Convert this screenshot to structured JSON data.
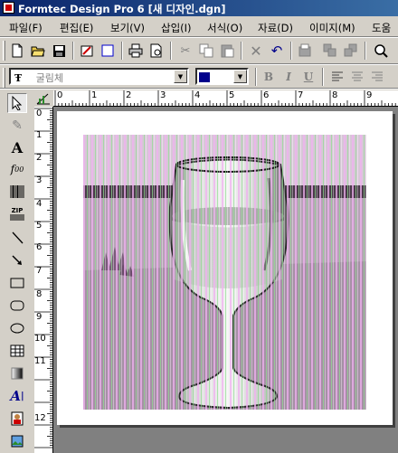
{
  "window": {
    "title": "Formtec Design Pro 6 [새 디자인.dgn]"
  },
  "menu": {
    "items": [
      "파일(F)",
      "편집(E)",
      "보기(V)",
      "삽입(I)",
      "서식(O)",
      "자료(D)",
      "이미지(M)",
      "도움"
    ]
  },
  "toolbar_main": {
    "buttons": [
      "new-icon",
      "open-icon",
      "save-icon",
      "properties-icon",
      "rectangle-icon",
      "print-icon",
      "print-preview-icon",
      "cut-icon",
      "copy-icon",
      "paste-icon",
      "delete-icon",
      "undo-icon",
      "page-setup-icon",
      "group-icon",
      "ungroup-icon",
      "zoom-icon"
    ]
  },
  "toolbar_format": {
    "font_name": "굴림체",
    "font_size": "",
    "bold_label": "B",
    "italic_label": "I",
    "underline_label": "U"
  },
  "tools": [
    "select-tool",
    "pen-tool",
    "text-tool",
    "formula-tool",
    "barcode-tool",
    "zip-tool",
    "line-tool",
    "arrow-tool",
    "rectangle-tool",
    "rounded-rectangle-tool",
    "ellipse-tool",
    "table-tool",
    "gradient-tool",
    "rotated-text-tool",
    "image-tool",
    "picture-tool"
  ],
  "tool_labels": {
    "zip": "ZIP"
  },
  "ruler": {
    "top_marks": [
      "0",
      "1",
      "2",
      "3",
      "4",
      "5",
      "6",
      "7",
      "8",
      "9"
    ],
    "left_marks": [
      "0",
      "1",
      "2",
      "3",
      "4",
      "5",
      "6",
      "7",
      "8",
      "9",
      "10",
      "11",
      "12"
    ]
  },
  "colors": {
    "titlebar_start": "#0a246a",
    "titlebar_end": "#3a6ea5",
    "workspace": "#808080",
    "chrome": "#d4d0c8"
  }
}
